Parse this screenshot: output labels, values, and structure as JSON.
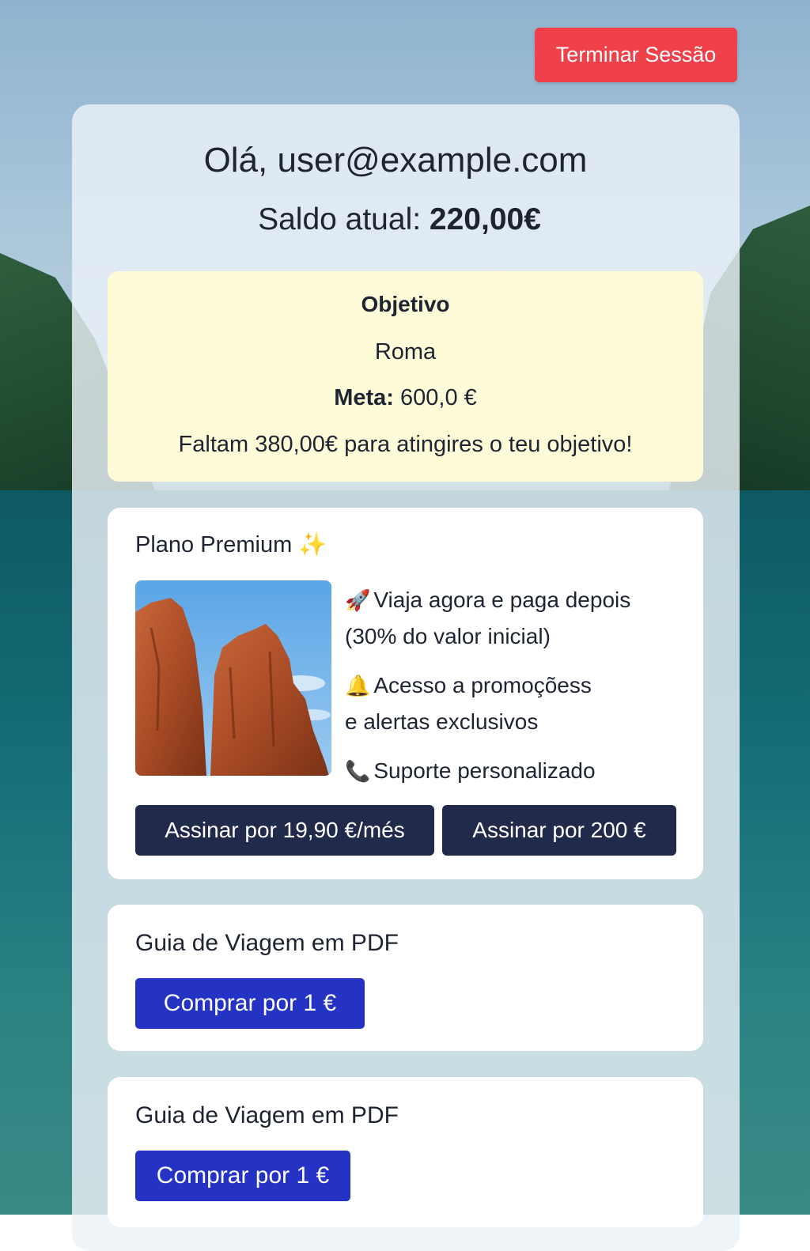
{
  "header": {
    "logout_label": "Terminar Sessão"
  },
  "user": {
    "greeting": "Olá, user@example.com",
    "balance_label": "Saldo atual:",
    "balance_value": "220,00€"
  },
  "goal": {
    "title": "Objetivo",
    "destination": "Roma",
    "meta_label": "Meta:",
    "meta_value": "600,0 €",
    "missing_text": "Faltam 380,00€ para atingires o teu objetivo!"
  },
  "premium": {
    "title": "Plano Premium",
    "title_icon": "✨",
    "features": [
      {
        "icon": "rocket-icon",
        "glyph": "🚀",
        "text_line1": "Viaja agora e paga depois",
        "text_line2": "(30% do valor inicial)"
      },
      {
        "icon": "bell-icon",
        "glyph": "🔔",
        "text_line1": "Acesso a promoçõess",
        "text_line2": "e alertas exclusivos"
      },
      {
        "icon": "phone-icon",
        "glyph": "📞",
        "text_line1": "Suporte personalizado",
        "text_line2": ""
      }
    ],
    "monthly_button": "Assinar por 19,90 €/més",
    "yearly_button": "Assinar por 200 €"
  },
  "products": [
    {
      "title": "Guia de Viagem em PDF",
      "button": "Comprar por  1  €"
    },
    {
      "title": "Guia de Viagem em PDF",
      "button": "Comprar por 1 €"
    }
  ],
  "colors": {
    "logout": "#f0404a",
    "dark_button": "#222a4b",
    "blue_button": "#2433c4",
    "goal_card": "#fefbd8"
  }
}
